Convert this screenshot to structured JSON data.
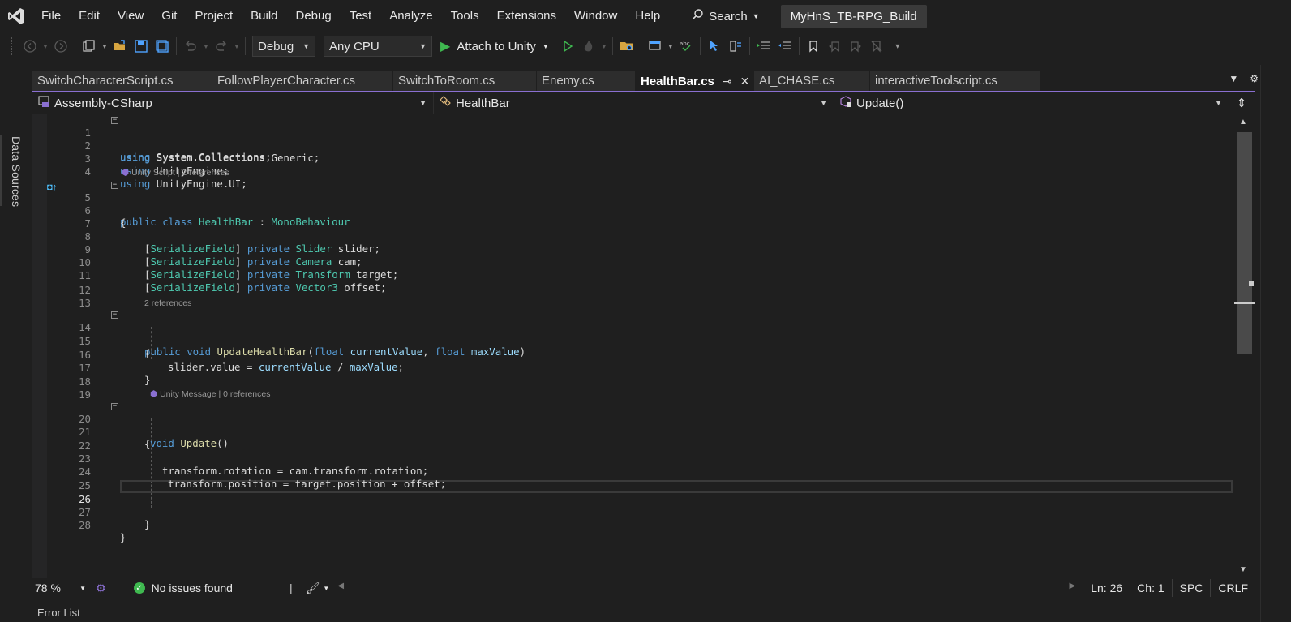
{
  "menu": {
    "items": [
      "File",
      "Edit",
      "View",
      "Git",
      "Project",
      "Build",
      "Debug",
      "Test",
      "Analyze",
      "Tools",
      "Extensions",
      "Window",
      "Help"
    ],
    "search_label": "Search",
    "solution_name": "MyHnS_TB-RPG_Build"
  },
  "toolbar": {
    "configuration": "Debug",
    "platform": "Any CPU",
    "attach_label": "Attach to Unity"
  },
  "left_panel": {
    "tab_label": "Data Sources"
  },
  "tabs": [
    {
      "label": "SwitchCharacterScript.cs"
    },
    {
      "label": "FollowPlayerCharacter.cs"
    },
    {
      "label": "SwitchToRoom.cs"
    },
    {
      "label": "Enemy.cs"
    },
    {
      "label": "HealthBar.cs"
    },
    {
      "label": "AI_CHASE.cs"
    },
    {
      "label": "interactiveToolscript.cs"
    }
  ],
  "navbar": {
    "project": "Assembly-CSharp",
    "type": "HealthBar",
    "member": "Update()"
  },
  "codelens": {
    "class_lens": "Unity Script | 2 references",
    "method_lens": "2 references",
    "update_lens": "Unity Message | 0 references"
  },
  "code": {
    "l1": [
      "using",
      " System.Collections;"
    ],
    "l2": [
      "using",
      " System.Collections.Generic;"
    ],
    "l3": [
      "using",
      " UnityEngine;"
    ],
    "l4": [
      "using",
      " UnityEngine.UI;"
    ],
    "l5": [
      "public class ",
      "HealthBar",
      " : ",
      "MonoBehaviour"
    ],
    "l6": "{",
    "l8": [
      "[",
      "SerializeField",
      "] ",
      "private ",
      "Slider",
      " slider;"
    ],
    "l9": [
      "[",
      "SerializeField",
      "] ",
      "private ",
      "Camera",
      " cam;"
    ],
    "l10": [
      "[",
      "SerializeField",
      "] ",
      "private ",
      "Transform",
      " target;"
    ],
    "l11": [
      "[",
      "SerializeField",
      "] ",
      "private ",
      "Vector3",
      " offset;"
    ],
    "l14": [
      "public void ",
      "UpdateHealthBar",
      "(",
      "float ",
      "currentValue",
      ", ",
      "float ",
      "maxValue",
      ")"
    ],
    "l15": "{",
    "l16": [
      "slider.value = ",
      "currentValue",
      " / ",
      "maxValue",
      ";"
    ],
    "l17": "}",
    "l20": [
      "void ",
      "Update",
      "()"
    ],
    "l21": "{",
    "l23": "transform.rotation = cam.transform.rotation;",
    "l24": "transform.position = target.position + offset;",
    "l27": "}",
    "l28": "}",
    "line_numbers": [
      "1",
      "2",
      "3",
      "4",
      "5",
      "6",
      "7",
      "8",
      "9",
      "10",
      "11",
      "12",
      "13",
      "14",
      "15",
      "16",
      "17",
      "18",
      "19",
      "20",
      "21",
      "22",
      "23",
      "24",
      "25",
      "26",
      "27",
      "28"
    ]
  },
  "status": {
    "zoom": "78 %",
    "issues": "No issues found",
    "line": "Ln: 26",
    "col": "Ch: 1",
    "whitespace": "SPC",
    "eol": "CRLF"
  },
  "bottom_panel": {
    "title": "Error List"
  },
  "colors": {
    "accent": "#8a6fd1",
    "keyword": "#569cd6",
    "type": "#4ec9b0",
    "method": "#dcdcaa",
    "param": "#9cdcfe",
    "ok": "#3fb950"
  }
}
